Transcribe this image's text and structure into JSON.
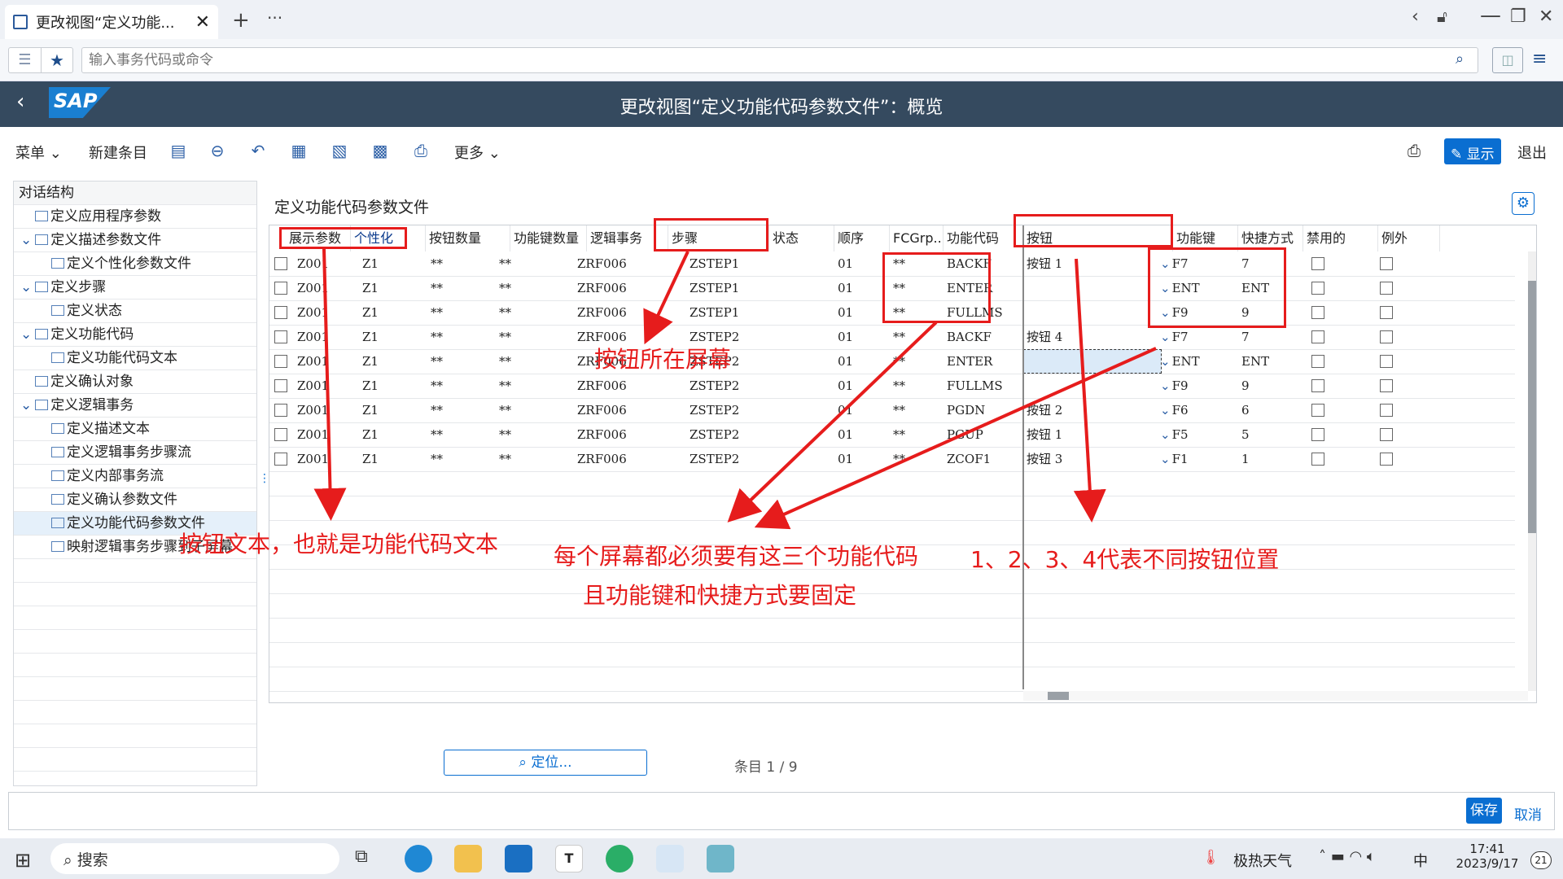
{
  "browser": {
    "tab_title": "更改视图“定义功能...",
    "address_placeholder": "输入事务代码或命令"
  },
  "shell": {
    "title": "更改视图“定义功能代码参数文件”：概览",
    "logo": "SAP"
  },
  "toolbar": {
    "menu": "菜单",
    "new_entry": "新建条目",
    "more": "更多",
    "display": "显示",
    "exit": "退出"
  },
  "tree": {
    "header": "对话结构",
    "items": [
      {
        "label": "定义应用程序参数",
        "level": 0,
        "expand": false
      },
      {
        "label": "定义描述参数文件",
        "level": 0,
        "expand": true
      },
      {
        "label": "定义个性化参数文件",
        "level": 1,
        "expand": false
      },
      {
        "label": "定义步骤",
        "level": 0,
        "expand": true
      },
      {
        "label": "定义状态",
        "level": 1,
        "expand": false
      },
      {
        "label": "定义功能代码",
        "level": 0,
        "expand": true
      },
      {
        "label": "定义功能代码文本",
        "level": 1,
        "expand": false
      },
      {
        "label": "定义确认对象",
        "level": 0,
        "expand": false
      },
      {
        "label": "定义逻辑事务",
        "level": 0,
        "expand": true
      },
      {
        "label": "定义描述文本",
        "level": 1,
        "expand": false
      },
      {
        "label": "定义逻辑事务步骤流",
        "level": 1,
        "expand": false
      },
      {
        "label": "定义内部事务流",
        "level": 1,
        "expand": false
      },
      {
        "label": "定义确认参数文件",
        "level": 1,
        "expand": false
      },
      {
        "label": "定义功能代码参数文件",
        "level": 1,
        "expand": false,
        "selected": true
      },
      {
        "label": "映射逻辑事务步骤到子屏幕",
        "level": 1,
        "expand": false
      }
    ]
  },
  "content": {
    "title": "定义功能代码参数文件",
    "columns": [
      "展示参数",
      "个性化",
      "按钮数量",
      "功能键数量",
      "逻辑事务",
      "步骤",
      "状态",
      "顺序",
      "FCGrp...",
      "功能代码",
      "按钮",
      "功能键",
      "快捷方式",
      "禁用的",
      "例外"
    ],
    "rows": [
      [
        "Z001",
        "Z1",
        "**",
        "**",
        "ZRF006",
        "ZSTEP1",
        "",
        "01",
        "**",
        "BACKF",
        "按钮 1",
        "F7",
        "7"
      ],
      [
        "Z001",
        "Z1",
        "**",
        "**",
        "ZRF006",
        "ZSTEP1",
        "",
        "01",
        "**",
        "ENTER",
        "",
        "ENT",
        "ENT"
      ],
      [
        "Z001",
        "Z1",
        "**",
        "**",
        "ZRF006",
        "ZSTEP1",
        "",
        "01",
        "**",
        "FULLMS",
        "",
        "F9",
        "9"
      ],
      [
        "Z001",
        "Z1",
        "**",
        "**",
        "ZRF006",
        "ZSTEP2",
        "",
        "01",
        "**",
        "BACKF",
        "按钮 4",
        "F7",
        "7"
      ],
      [
        "Z001",
        "Z1",
        "**",
        "**",
        "ZRF006",
        "ZSTEP2",
        "",
        "01",
        "**",
        "ENTER",
        "",
        "ENT",
        "ENT"
      ],
      [
        "Z001",
        "Z1",
        "**",
        "**",
        "ZRF006",
        "ZSTEP2",
        "",
        "01",
        "**",
        "FULLMS",
        "",
        "F9",
        "9"
      ],
      [
        "Z001",
        "Z1",
        "**",
        "**",
        "ZRF006",
        "ZSTEP2",
        "",
        "01",
        "**",
        "PGDN",
        "按钮 2",
        "F6",
        "6"
      ],
      [
        "Z001",
        "Z1",
        "**",
        "**",
        "ZRF006",
        "ZSTEP2",
        "",
        "01",
        "**",
        "PGUP",
        "按钮 1",
        "F5",
        "5"
      ],
      [
        "Z001",
        "Z1",
        "**",
        "**",
        "ZRF006",
        "ZSTEP2",
        "",
        "01",
        "**",
        "ZCOF1",
        "按钮 3",
        "F1",
        "1"
      ]
    ],
    "locate": "定位...",
    "entries": "条目 1 / 9"
  },
  "footer": {
    "save": "保存",
    "cancel": "取消"
  },
  "annotations": {
    "screen": "按钮所在屏幕",
    "button_text": "按钮文本，也就是功能代码文本",
    "must_have1": "每个屏幕都必须要有这三个功能代码",
    "must_have2": "且功能键和快捷方式要固定",
    "positions": "1、2、3、4代表不同按钮位置"
  },
  "taskbar": {
    "search": "搜索",
    "weather": "极热天气",
    "ime": "中",
    "time": "17:41",
    "date": "2023/9/17",
    "notif": "21"
  },
  "colors": {
    "shell": "#354a5f",
    "accent": "#0a6ed1",
    "annotation": "#e61c1c"
  }
}
